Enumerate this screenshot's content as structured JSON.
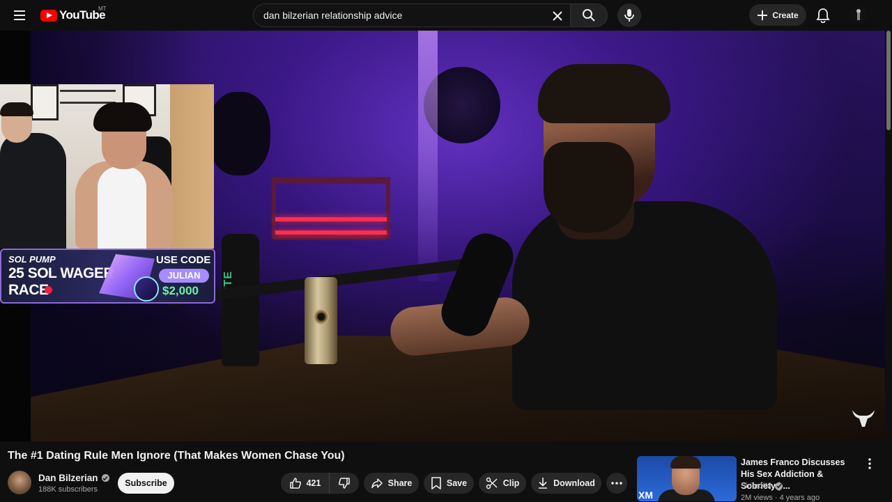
{
  "header": {
    "logo_text": "YouTube",
    "country_code": "MT",
    "search": {
      "value": "dan bilzerian relationship advice"
    },
    "create_label": "Create"
  },
  "video": {
    "overlay_promo": {
      "brand": "SOL PUMP",
      "title_line1": "25 SOL WAGER",
      "title_line2": "RACE",
      "use_code_label": "USE CODE",
      "code": "JULIAN",
      "amount": "$2,000"
    },
    "bottle_text": "NITE"
  },
  "info": {
    "title": "The #1 Dating Rule Men Ignore (That Makes Women Chase You)",
    "channel": {
      "name": "Dan Bilzerian",
      "subscribers": "188K subscribers"
    },
    "subscribe_label": "Subscribe",
    "actions": {
      "like_count": "421",
      "share_label": "Share",
      "save_label": "Save",
      "clip_label": "Clip",
      "download_label": "Download"
    }
  },
  "recommendation": {
    "title": "James Franco Discusses His Sex Addiction & Sobriety | ...",
    "channel": "SiriusXM",
    "meta": "2M views · 4 years ago",
    "thumb_text": "XM"
  },
  "colors": {
    "background": "#0f0f0f",
    "brand_red": "#ff0000",
    "pill_bg": "#272727",
    "promo_accent": "#a68cff",
    "promo_amount": "#6ff0a8"
  }
}
